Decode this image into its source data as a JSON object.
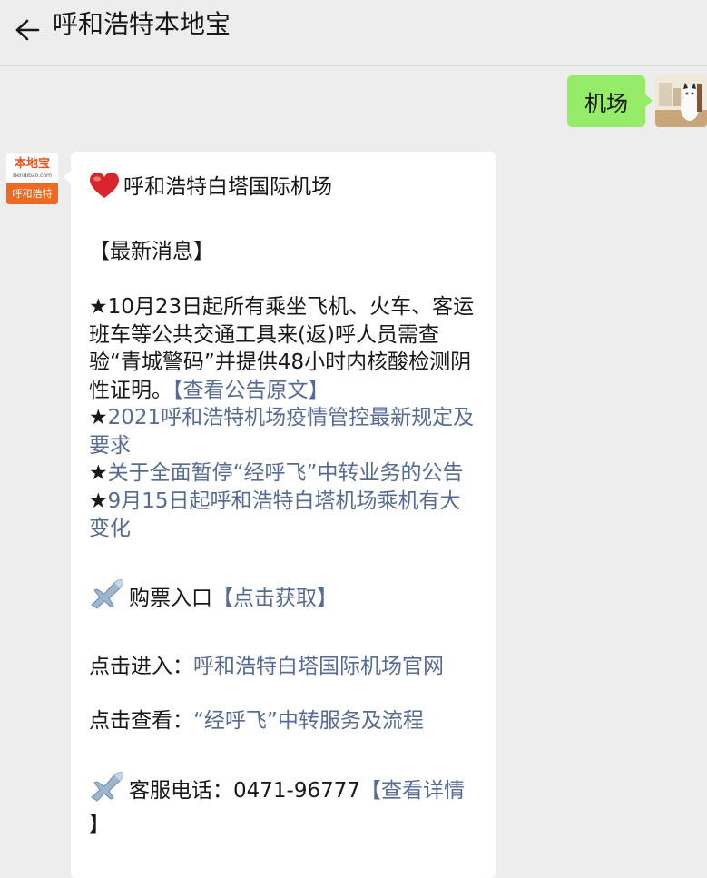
{
  "header": {
    "title": "呼和浩特本地宝",
    "back_icon": "back-arrow-icon"
  },
  "user_message": {
    "text": "机场",
    "bubble_color": "#95ec69"
  },
  "bot_avatar": {
    "brand_name": "本地宝",
    "domain": "Bendibao.com",
    "city": "呼和浩特"
  },
  "bot_message": {
    "heading_icon": "heart-icon",
    "heading": "呼和浩特白塔国际机场",
    "section_title": "【最新消息】",
    "news1_text": "★10月23日起所有乘坐飞机、火车、客运班车等公共交通工具来(返)呼人员需查验“青城警码”并提供48小时内核酸检测阴性证明。",
    "news1_link": "【查看公告原文】",
    "star": "★",
    "news2_link": "2021呼和浩特机场疫情管控最新规定及要求",
    "news3_link": "关于全面暂停“经呼飞”中转业务的公告",
    "news4_link": "9月15日起呼和浩特白塔机场乘机有大变化",
    "ticket_icon": "airplane-icon",
    "ticket_label": "购票入口",
    "ticket_link": "【点击获取】",
    "enter_label": "点击进入：",
    "enter_link": "呼和浩特白塔国际机场官网",
    "view_label": "点击查看：",
    "view_link": "“经呼飞”中转服务及流程",
    "service_icon": "airplane-icon",
    "service_label": "客服电话：0471-96777",
    "service_link": "【查看详情",
    "service_link_end": "】",
    "link_color": "#576b95"
  }
}
